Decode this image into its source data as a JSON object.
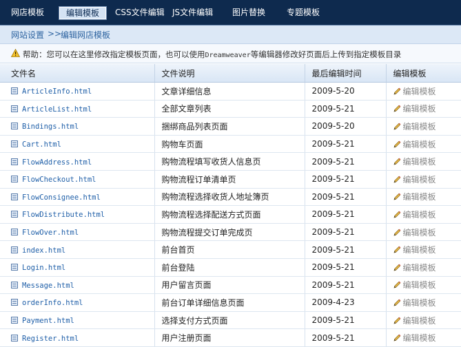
{
  "nav": {
    "tabs": [
      {
        "label": "网店模板"
      },
      {
        "label": "编辑模板"
      },
      {
        "label": "CSS文件编辑"
      },
      {
        "label": "JS文件编辑"
      },
      {
        "label": "图片替换"
      },
      {
        "label": "专题模板"
      }
    ],
    "active_tab": "编辑模板"
  },
  "breadcrumb": {
    "root": "网站设置",
    "separator": ">>",
    "current": "编辑网店模板"
  },
  "help": {
    "prefix": "帮助：您可以在这里修改指定模板页面，也可以使用",
    "app": "Dreamweaver",
    "suffix": "等编辑器修改好页面后上传到指定模板目录"
  },
  "table": {
    "headers": [
      "文件名",
      "文件说明",
      "最后编辑时间",
      "编辑模板"
    ],
    "rows": [
      {
        "file": "ArticleInfo.html",
        "desc": "文章详细信息",
        "date": "2009-5-20",
        "action": "编辑模板"
      },
      {
        "file": "ArticleList.html",
        "desc": "全部文章列表",
        "date": "2009-5-21",
        "action": "编辑模板"
      },
      {
        "file": "Bindings.html",
        "desc": "捆绑商品列表页面",
        "date": "2009-5-20",
        "action": "编辑模板"
      },
      {
        "file": "Cart.html",
        "desc": "购物车页面",
        "date": "2009-5-21",
        "action": "编辑模板"
      },
      {
        "file": "FlowAddress.html",
        "desc": "购物流程填写收货人信息页",
        "date": "2009-5-21",
        "action": "编辑模板"
      },
      {
        "file": "FlowCheckout.html",
        "desc": "购物流程订单清单页",
        "date": "2009-5-21",
        "action": "编辑模板"
      },
      {
        "file": "FlowConsignee.html",
        "desc": "购物流程选择收货人地址簿页",
        "date": "2009-5-21",
        "action": "编辑模板"
      },
      {
        "file": "FlowDistribute.html",
        "desc": "购物流程选择配送方式页面",
        "date": "2009-5-21",
        "action": "编辑模板"
      },
      {
        "file": "FlowOver.html",
        "desc": "购物流程提交订单完成页",
        "date": "2009-5-21",
        "action": "编辑模板"
      },
      {
        "file": "index.html",
        "desc": "前台首页",
        "date": "2009-5-21",
        "action": "编辑模板"
      },
      {
        "file": "Login.html",
        "desc": "前台登陆",
        "date": "2009-5-21",
        "action": "编辑模板"
      },
      {
        "file": "Message.html",
        "desc": "用户留言页面",
        "date": "2009-5-21",
        "action": "编辑模板"
      },
      {
        "file": "orderInfo.html",
        "desc": "前台订单详细信息页面",
        "date": "2009-4-23",
        "action": "编辑模板"
      },
      {
        "file": "Payment.html",
        "desc": "选择支付方式页面",
        "date": "2009-5-21",
        "action": "编辑模板"
      },
      {
        "file": "Register.html",
        "desc": "用户注册页面",
        "date": "2009-5-21",
        "action": "编辑模板"
      }
    ]
  },
  "icons": {
    "help": "warning-icon",
    "file": "document-icon",
    "edit": "pencil-icon"
  },
  "colors": {
    "nav_bg": "#0e2a4e",
    "link": "#1f5fa8",
    "crumb": "#2d63a0",
    "disabled_action": "#8a8a8a"
  }
}
